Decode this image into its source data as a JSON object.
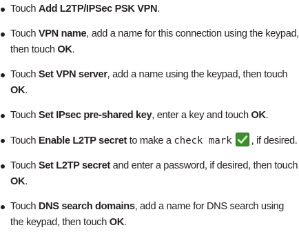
{
  "steps": [
    {
      "parts": [
        {
          "t": "Touch ",
          "b": false
        },
        {
          "t": "Add L2TP/IPSec PSK VPN",
          "b": true
        },
        {
          "t": ".",
          "b": false
        }
      ]
    },
    {
      "parts": [
        {
          "t": "Touch ",
          "b": false
        },
        {
          "t": "VPN name",
          "b": true
        },
        {
          "t": ", add a name for this connection using the keypad, then touch ",
          "b": false
        },
        {
          "t": "OK",
          "b": true
        },
        {
          "t": ".",
          "b": false
        }
      ]
    },
    {
      "parts": [
        {
          "t": "Touch ",
          "b": false
        },
        {
          "t": "Set VPN server",
          "b": true
        },
        {
          "t": ", add a name using the keypad, then touch ",
          "b": false
        },
        {
          "t": "OK",
          "b": true
        },
        {
          "t": ".",
          "b": false
        }
      ]
    },
    {
      "parts": [
        {
          "t": "Touch ",
          "b": false
        },
        {
          "t": "Set IPsec pre-shared key",
          "b": true
        },
        {
          "t": ", enter a key and touch ",
          "b": false
        },
        {
          "t": "OK",
          "b": true
        },
        {
          "t": ".",
          "b": false
        }
      ]
    },
    {
      "parts": [
        {
          "t": "Touch ",
          "b": false
        },
        {
          "t": "Enable L2TP secret",
          "b": true
        },
        {
          "t": " to make a ",
          "b": false
        },
        {
          "t": "check mark",
          "b": false,
          "mono": true
        },
        {
          "icon": "check-mark-icon"
        },
        {
          "t": ", if desired.",
          "b": false
        }
      ]
    },
    {
      "parts": [
        {
          "t": "Touch ",
          "b": false
        },
        {
          "t": "Set L2TP secret",
          "b": true
        },
        {
          "t": " and enter a password, if desired, then touch ",
          "b": false
        },
        {
          "t": "OK",
          "b": true
        },
        {
          "t": ".",
          "b": false
        }
      ]
    },
    {
      "parts": [
        {
          "t": "Touch ",
          "b": false
        },
        {
          "t": "DNS search domains",
          "b": true
        },
        {
          "t": ", add a name for DNS search using the keypad, then touch ",
          "b": false
        },
        {
          "t": "OK",
          "b": true
        },
        {
          "t": ".",
          "b": false
        }
      ]
    }
  ],
  "colors": {
    "text": "#231f20",
    "checkbox_fill": "#3f8f2f",
    "checkbox_border": "#1f5e1c",
    "checkmark": "#d9f7c0"
  }
}
